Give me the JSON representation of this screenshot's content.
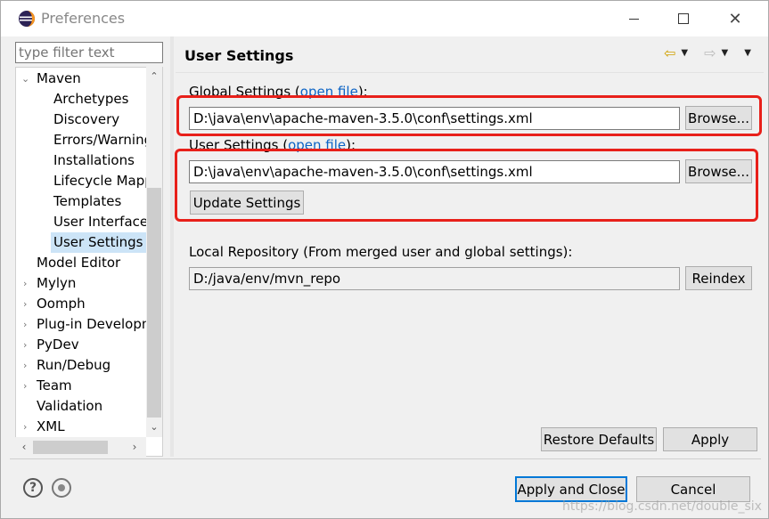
{
  "window": {
    "title": "Preferences",
    "controls": {
      "minimize": "minimize",
      "maximize": "maximize",
      "close": "✕"
    }
  },
  "sidebar": {
    "filter_placeholder": "type filter text",
    "tree": [
      {
        "label": "Maven",
        "expanded": true,
        "level": 0
      },
      {
        "label": "Archetypes",
        "level": 1
      },
      {
        "label": "Discovery",
        "level": 1
      },
      {
        "label": "Errors/Warnings",
        "level": 1
      },
      {
        "label": "Installations",
        "level": 1
      },
      {
        "label": "Lifecycle Mappings",
        "level": 1
      },
      {
        "label": "Templates",
        "level": 1
      },
      {
        "label": "User Interface",
        "level": 1
      },
      {
        "label": "User Settings",
        "level": 1,
        "selected": true
      },
      {
        "label": "Model Editor",
        "level": 0
      },
      {
        "label": "Mylyn",
        "level": 0,
        "collapsed": true
      },
      {
        "label": "Oomph",
        "level": 0,
        "collapsed": true
      },
      {
        "label": "Plug-in Development",
        "level": 0,
        "collapsed": true
      },
      {
        "label": "PyDev",
        "level": 0,
        "collapsed": true
      },
      {
        "label": "Run/Debug",
        "level": 0,
        "collapsed": true
      },
      {
        "label": "Team",
        "level": 0,
        "collapsed": true
      },
      {
        "label": "Validation",
        "level": 0
      },
      {
        "label": "XML",
        "level": 0,
        "collapsed": true
      }
    ]
  },
  "page": {
    "title": "User Settings",
    "global_settings": {
      "label_prefix": "Global Settings (",
      "link": "open file",
      "label_suffix": "):",
      "value": "D:\\java\\env\\apache-maven-3.5.0\\conf\\settings.xml",
      "browse": "Browse..."
    },
    "user_settings": {
      "label_prefix": "User Settings (",
      "link": "open file",
      "label_suffix": "):",
      "value": "D:\\java\\env\\apache-maven-3.5.0\\conf\\settings.xml",
      "browse": "Browse...",
      "update": "Update Settings"
    },
    "local_repository": {
      "label": "Local Repository (From merged user and global settings):",
      "value": "D:/java/env/mvn_repo",
      "reindex": "Reindex"
    },
    "restore_defaults": "Restore Defaults",
    "apply": "Apply"
  },
  "footer": {
    "apply_and_close": "Apply and Close",
    "cancel": "Cancel",
    "watermark": "https://blog.csdn.net/double_six"
  },
  "colors": {
    "accent": "#0078d7",
    "highlight": "#e8201a",
    "link": "#0b63c5",
    "selection": "#cce4f7"
  }
}
